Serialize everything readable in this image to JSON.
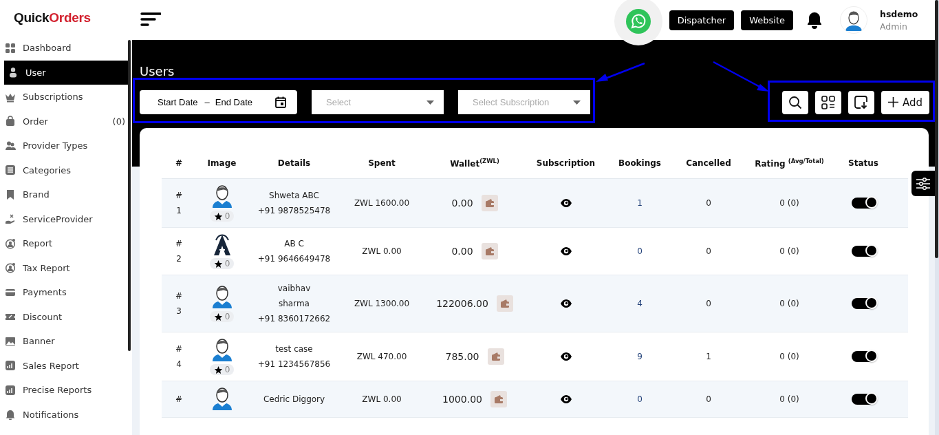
{
  "logo": {
    "text_1": "Quick",
    "text_2": "Orders"
  },
  "sidebar": {
    "items": [
      {
        "label": "Dashboard",
        "selected": false
      },
      {
        "label": "User",
        "selected": true
      },
      {
        "label": "Subscriptions",
        "selected": false
      },
      {
        "label": "Order",
        "selected": false,
        "count": "(0)"
      },
      {
        "label": "Provider Types",
        "selected": false
      },
      {
        "label": "Categories",
        "selected": false
      },
      {
        "label": "Brand",
        "selected": false
      },
      {
        "label": "ServiceProvider",
        "selected": false
      },
      {
        "label": "Report",
        "selected": false
      },
      {
        "label": "Tax Report",
        "selected": false
      },
      {
        "label": "Payments",
        "selected": false
      },
      {
        "label": "Discount",
        "selected": false
      },
      {
        "label": "Banner",
        "selected": false
      },
      {
        "label": "Sales Report",
        "selected": false
      },
      {
        "label": "Precise Reports",
        "selected": false
      },
      {
        "label": "Notifications",
        "selected": false
      }
    ]
  },
  "topbar": {
    "buttons": [
      "Dispatcher",
      "Website"
    ],
    "user": {
      "name": "hsdemo",
      "role": "Admin"
    }
  },
  "page_title": "Users",
  "filters": {
    "date_range": {
      "start": "Start Date",
      "separator": "–",
      "end": "End Date"
    },
    "selects": [
      {
        "placeholder": "Select"
      },
      {
        "placeholder": "Select Subscription"
      }
    ]
  },
  "toolbar": {
    "add_button": "Add"
  },
  "table": {
    "columns": [
      "#",
      "Image",
      "Details",
      "Spent",
      "Wallet$^{(ZWL)}$",
      "Subscription",
      "Bookings",
      "Cancelled",
      "Rating $^{(Avg/Total)}$",
      "Status"
    ],
    "rows": [
      {
        "hash": "#",
        "number": "1",
        "kind": "person",
        "stars_text": "0",
        "name": "Shweta ABC",
        "phone": "+91 9878525478",
        "spent": "ZWL 1600.00",
        "wallet": "0.00",
        "bookings": "1",
        "cancelled": "0",
        "rating": "0 (0)",
        "status": true
      },
      {
        "hash": "#",
        "number": "2",
        "kind": "logo",
        "stars_text": "0",
        "name": "AB C",
        "phone": "+91 9646649478",
        "spent": "ZWL 0.00",
        "wallet": "0.00",
        "bookings": "0",
        "cancelled": "0",
        "rating": "0 (0)",
        "status": true
      },
      {
        "hash": "#",
        "number": "3",
        "kind": "person",
        "stars_text": "0",
        "name": "vaibhav\nsharma",
        "phone": "+91 8360172662",
        "spent": "ZWL 1300.00",
        "wallet": "122006.00",
        "bookings": "4",
        "cancelled": "0",
        "rating": "0 (0)",
        "status": true
      },
      {
        "hash": "#",
        "number": "4",
        "kind": "person",
        "stars_text": "0",
        "name": "test case",
        "phone": "+91 1234567856",
        "spent": "ZWL 470.00",
        "wallet": "785.00",
        "bookings": "9",
        "cancelled": "1",
        "rating": "0 (0)",
        "status": true
      },
      {
        "hash": "#",
        "kind": "person",
        "name": "Cedric Diggory",
        "spent": "ZWL 0.00",
        "wallet": "1000.00",
        "bookings": "0",
        "cancelled": "0",
        "rating": "0 (0)",
        "status": true
      }
    ]
  }
}
